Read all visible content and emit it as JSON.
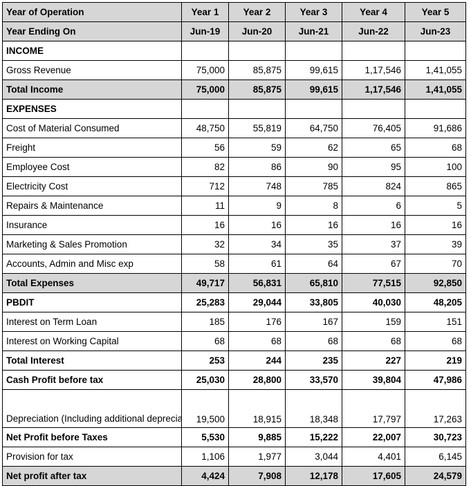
{
  "document": {
    "type": "financial-projection-table",
    "colors": {
      "header_fill": "#d6d6d6",
      "subtotal_fill": "#d6d6d6",
      "value_blue": "#4a7ebb",
      "value_black": "#1a1a1a",
      "border": "#000000"
    }
  },
  "table": {
    "header_rows": [
      {
        "label": "Year of Operation",
        "values": [
          "Year 1",
          "Year 2",
          "Year 3",
          "Year 4",
          "Year 5"
        ]
      },
      {
        "label": "Year Ending On",
        "values": [
          "Jun-19",
          "Jun-20",
          "Jun-21",
          "Jun-22",
          "Jun-23"
        ]
      }
    ],
    "rows": [
      {
        "label": "INCOME",
        "values": [
          "",
          "",
          "",
          "",
          ""
        ],
        "style": "section",
        "value_style": "blank"
      },
      {
        "label": "Gross Revenue",
        "values": [
          "75,000",
          "85,875",
          "99,615",
          "1,17,546",
          "1,41,055"
        ],
        "style": "normal",
        "value_style": "blue"
      },
      {
        "label": "Total Income",
        "values": [
          "75,000",
          "85,875",
          "99,615",
          "1,17,546",
          "1,41,055"
        ],
        "style": "subtotal",
        "value_style": "bold"
      },
      {
        "label": "EXPENSES",
        "values": [
          "",
          "",
          "",
          "",
          ""
        ],
        "style": "section",
        "value_style": "blank"
      },
      {
        "label": "Cost of Material Consumed",
        "values": [
          "48,750",
          "55,819",
          "64,750",
          "76,405",
          "91,686"
        ],
        "style": "normal",
        "value_style": "dark"
      },
      {
        "label": "Freight",
        "values": [
          "56",
          "59",
          "62",
          "65",
          "68"
        ],
        "style": "normal",
        "value_style": "blue"
      },
      {
        "label": "Employee Cost",
        "values": [
          "82",
          "86",
          "90",
          "95",
          "100"
        ],
        "style": "normal",
        "value_style": "blue"
      },
      {
        "label": "Electricity Cost",
        "values": [
          "712",
          "748",
          "785",
          "824",
          "865"
        ],
        "style": "normal",
        "value_style": "blue"
      },
      {
        "label": "Repairs & Maintenance",
        "values": [
          "11",
          "9",
          "8",
          "6",
          "5"
        ],
        "style": "normal",
        "value_style": "blue"
      },
      {
        "label": "Insurance",
        "values": [
          "16",
          "16",
          "16",
          "16",
          "16"
        ],
        "style": "normal",
        "value_style": "blue"
      },
      {
        "label": "Marketing & Sales Promotion",
        "values": [
          "32",
          "34",
          "35",
          "37",
          "39"
        ],
        "style": "normal",
        "value_style": "blue"
      },
      {
        "label": "Accounts, Admin and Misc exp",
        "values": [
          "58",
          "61",
          "64",
          "67",
          "70"
        ],
        "style": "normal",
        "value_style": "blue"
      },
      {
        "label": "Total Expenses",
        "values": [
          "49,717",
          "56,831",
          "65,810",
          "77,515",
          "92,850"
        ],
        "style": "subtotal",
        "value_style": "bold"
      },
      {
        "label": "PBDIT",
        "values": [
          "25,283",
          "29,044",
          "33,805",
          "40,030",
          "48,205"
        ],
        "style": "total-plain",
        "value_style": "bold"
      },
      {
        "label": "Interest on Term Loan",
        "values": [
          "185",
          "176",
          "167",
          "159",
          "151"
        ],
        "style": "normal",
        "value_style": "blue"
      },
      {
        "label": "Interest on Working Capital",
        "values": [
          "68",
          "68",
          "68",
          "68",
          "68"
        ],
        "style": "normal",
        "value_style": "blue"
      },
      {
        "label": "Total Interest",
        "values": [
          "253",
          "244",
          "235",
          "227",
          "219"
        ],
        "style": "total-plain",
        "value_style": "bold"
      },
      {
        "label": "Cash Profit before tax",
        "values": [
          "25,030",
          "28,800",
          "33,570",
          "39,804",
          "47,986"
        ],
        "style": "total-plain",
        "value_style": "bold"
      },
      {
        "label": "Depreciation (Including additional depreciation)",
        "values": [
          "19,500",
          "18,915",
          "18,348",
          "17,797",
          "17,263"
        ],
        "style": "tall",
        "value_style": "blue"
      },
      {
        "label": "Net Profit before Taxes",
        "values": [
          "5,530",
          "9,885",
          "15,222",
          "22,007",
          "30,723"
        ],
        "style": "total-plain",
        "value_style": "bold"
      },
      {
        "label": "Provision for tax",
        "values": [
          "1,106",
          "1,977",
          "3,044",
          "4,401",
          "6,145"
        ],
        "style": "normal",
        "value_style": "dark"
      },
      {
        "label": "Net profit after tax",
        "values": [
          "4,424",
          "7,908",
          "12,178",
          "17,605",
          "24,579"
        ],
        "style": "subtotal",
        "value_style": "bold"
      }
    ]
  }
}
